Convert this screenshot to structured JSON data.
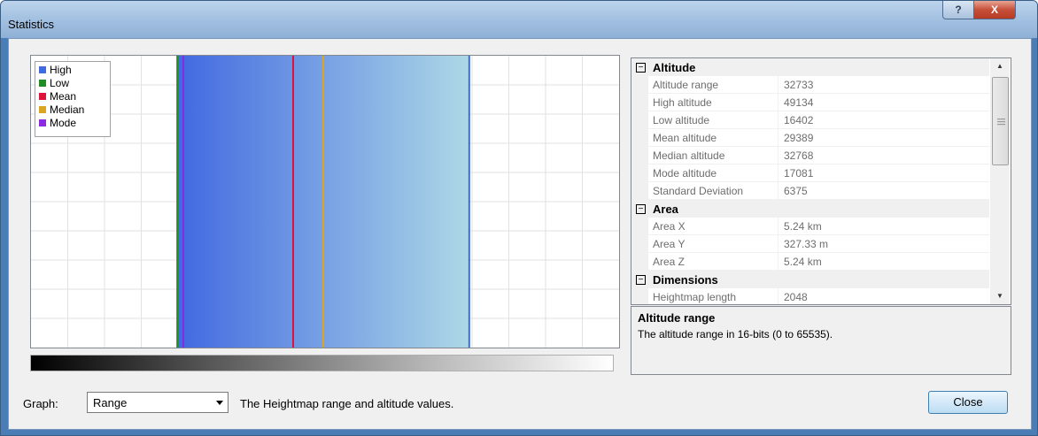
{
  "window": {
    "title": "Statistics",
    "help_label": "?",
    "close_label": "X"
  },
  "chart_data": {
    "type": "range",
    "legend": [
      {
        "name": "High",
        "color": "#4169e1"
      },
      {
        "name": "Low",
        "color": "#228b22"
      },
      {
        "name": "Mean",
        "color": "#dc143c"
      },
      {
        "name": "Median",
        "color": "#daa520"
      },
      {
        "name": "Mode",
        "color": "#8a2be2"
      }
    ],
    "xlim": [
      0,
      65535
    ],
    "range_gradient": [
      "#4169e1",
      "#add8e6"
    ],
    "values": {
      "high": 49134,
      "low": 16402,
      "mean": 29389,
      "median": 32768,
      "mode": 17081
    },
    "grid": true,
    "legend_position": "top-left"
  },
  "properties": {
    "categories": [
      {
        "label": "Altitude",
        "toggle": "−",
        "rows": [
          {
            "name": "Altitude range",
            "value": "32733"
          },
          {
            "name": "High altitude",
            "value": "49134"
          },
          {
            "name": "Low altitude",
            "value": "16402"
          },
          {
            "name": "Mean altitude",
            "value": "29389"
          },
          {
            "name": "Median altitude",
            "value": "32768"
          },
          {
            "name": "Mode altitude",
            "value": "17081"
          },
          {
            "name": "Standard Deviation",
            "value": "6375"
          }
        ]
      },
      {
        "label": "Area",
        "toggle": "−",
        "rows": [
          {
            "name": "Area X",
            "value": "5.24 km"
          },
          {
            "name": "Area Y",
            "value": "327.33 m"
          },
          {
            "name": "Area Z",
            "value": "5.24 km"
          }
        ]
      },
      {
        "label": "Dimensions",
        "toggle": "−",
        "rows": [
          {
            "name": "Heightmap length",
            "value": "2048"
          }
        ]
      }
    ],
    "description": {
      "title": "Altitude range",
      "text": "The altitude range in 16-bits (0 to 65535)."
    }
  },
  "footer": {
    "graph_label": "Graph:",
    "graph_value": "Range",
    "graph_description": "The Heightmap range and altitude values.",
    "close_button": "Close"
  }
}
